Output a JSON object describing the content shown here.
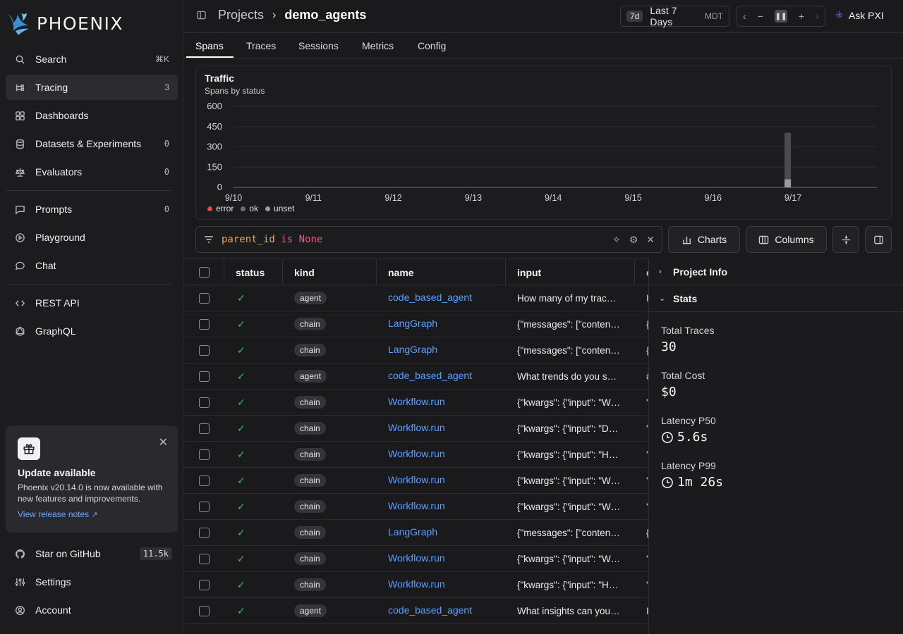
{
  "app": {
    "name": "PHOENIX"
  },
  "sidebar": {
    "items": [
      {
        "label": "Search",
        "count": "⌘K",
        "icon": "search-icon"
      },
      {
        "label": "Tracing",
        "count": "3",
        "icon": "tracing-icon"
      },
      {
        "label": "Dashboards",
        "count": "",
        "icon": "grid-icon"
      },
      {
        "label": "Datasets & Experiments",
        "count": "0",
        "icon": "database-icon"
      },
      {
        "label": "Evaluators",
        "count": "0",
        "icon": "scale-icon"
      },
      {
        "label": "Prompts",
        "count": "0",
        "icon": "message-square-icon"
      },
      {
        "label": "Playground",
        "count": "",
        "icon": "play-circle-icon"
      },
      {
        "label": "Chat",
        "count": "",
        "icon": "chat-bubble-icon"
      },
      {
        "label": "REST API",
        "count": "",
        "icon": "code-icon"
      },
      {
        "label": "GraphQL",
        "count": "",
        "icon": "graphql-icon"
      }
    ],
    "update": {
      "title": "Update available",
      "body": "Phoenix v20.14.0 is now available with new features and improvements.",
      "link": "View release notes"
    },
    "bottom": [
      {
        "label": "Star on GitHub",
        "count": "11.5k",
        "icon": "github-icon"
      },
      {
        "label": "Settings",
        "count": "",
        "icon": "sliders-icon"
      },
      {
        "label": "Account",
        "count": "",
        "icon": "user-circle-icon"
      }
    ]
  },
  "header": {
    "breadcrumb_root": "Projects",
    "project": "demo_agents",
    "time_tag": "7d",
    "time_label": "Last 7 Days",
    "timezone": "MDT",
    "ask": "Ask PXI"
  },
  "tabs": [
    "Spans",
    "Traces",
    "Sessions",
    "Metrics",
    "Config"
  ],
  "chart_data": {
    "type": "bar",
    "title": "Traffic",
    "subtitle": "Spans by status",
    "categories": [
      "9/10",
      "9/11",
      "9/12",
      "9/13",
      "9/14",
      "9/15",
      "9/16",
      "9/17"
    ],
    "yticks": [
      0,
      150,
      300,
      450,
      600
    ],
    "ylim": [
      0,
      600
    ],
    "series": [
      {
        "name": "error",
        "color": "#e5484d",
        "values": [
          0,
          0,
          0,
          0,
          0,
          0,
          0,
          0
        ]
      },
      {
        "name": "ok",
        "color": "#4a4a4f",
        "values": [
          0,
          0,
          0,
          0,
          0,
          0,
          0,
          345
        ]
      },
      {
        "name": "unset",
        "color": "#9a9aa0",
        "values": [
          0,
          0,
          0,
          0,
          0,
          0,
          0,
          60
        ]
      }
    ],
    "legend": "bottom-left"
  },
  "filter": {
    "field": "parent_id",
    "op": "is",
    "value": "None"
  },
  "toolbar": {
    "charts": "Charts",
    "columns": "Columns"
  },
  "table": {
    "columns": [
      "status",
      "kind",
      "name",
      "input"
    ],
    "rows": [
      {
        "kind": "agent",
        "name": "code_based_agent",
        "input": "How many of my trac…",
        "trail": "I"
      },
      {
        "kind": "chain",
        "name": "LangGraph",
        "input": "{\"messages\": [\"conten…",
        "trail": "{"
      },
      {
        "kind": "chain",
        "name": "LangGraph",
        "input": "{\"messages\": [\"conten…",
        "trail": "{"
      },
      {
        "kind": "agent",
        "name": "code_based_agent",
        "input": "What trends do you s…",
        "trail": "#"
      },
      {
        "kind": "chain",
        "name": "Workflow.run",
        "input": "{\"kwargs\": {\"input\": \"W…",
        "trail": "'"
      },
      {
        "kind": "chain",
        "name": "Workflow.run",
        "input": "{\"kwargs\": {\"input\": \"D…",
        "trail": "'"
      },
      {
        "kind": "chain",
        "name": "Workflow.run",
        "input": "{\"kwargs\": {\"input\": \"H…",
        "trail": "'"
      },
      {
        "kind": "chain",
        "name": "Workflow.run",
        "input": "{\"kwargs\": {\"input\": \"W…",
        "trail": "'"
      },
      {
        "kind": "chain",
        "name": "Workflow.run",
        "input": "{\"kwargs\": {\"input\": \"W…",
        "trail": "'"
      },
      {
        "kind": "chain",
        "name": "LangGraph",
        "input": "{\"messages\": [\"conten…",
        "trail": "{"
      },
      {
        "kind": "chain",
        "name": "Workflow.run",
        "input": "{\"kwargs\": {\"input\": \"W…",
        "trail": "'"
      },
      {
        "kind": "chain",
        "name": "Workflow.run",
        "input": "{\"kwargs\": {\"input\": \"H…",
        "trail": "'"
      },
      {
        "kind": "agent",
        "name": "code_based_agent",
        "input": "What insights can you…",
        "trail": "I"
      }
    ]
  },
  "panel": {
    "sections": [
      "Project Info",
      "Stats"
    ],
    "stats": [
      {
        "label": "Total Traces",
        "value": "30"
      },
      {
        "label": "Total Cost",
        "value": "$0"
      },
      {
        "label": "Latency P50",
        "value": "5.6s"
      },
      {
        "label": "Latency P99",
        "value": "1m 26s"
      }
    ]
  }
}
